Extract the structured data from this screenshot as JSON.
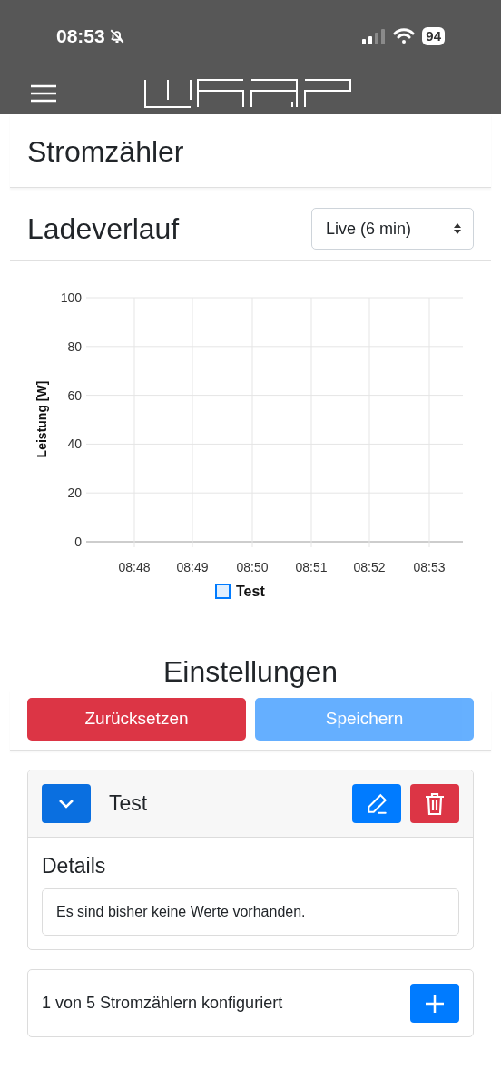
{
  "status_bar": {
    "time": "08:53",
    "battery": "94"
  },
  "sections": [
    {
      "title": "Stromzähler"
    }
  ],
  "history": {
    "title": "Ladeverlauf",
    "range_select": {
      "value": "Live (6 min)"
    },
    "chart_data": {
      "type": "line",
      "ylabel": "Leistung [W]",
      "categories": [
        "08:48",
        "08:49",
        "08:50",
        "08:51",
        "08:52",
        "08:53"
      ],
      "ylim": [
        0,
        100
      ],
      "yticks": [
        0,
        20,
        40,
        60,
        80,
        100
      ],
      "grid": true,
      "series": [
        {
          "name": "Test",
          "color": "#007bff",
          "values": [
            null,
            null,
            null,
            null,
            null,
            null
          ]
        }
      ]
    }
  },
  "settings": {
    "title": "Einstellungen",
    "buttons": [
      {
        "label": "Zurücksetzen",
        "kind": "danger",
        "disabled": false
      },
      {
        "label": "Speichern",
        "kind": "primary",
        "disabled": true
      }
    ]
  },
  "meters": [
    {
      "name": "Test",
      "expanded": true,
      "details_title": "Details",
      "details_text": "Es sind bisher keine Werte vorhanden."
    }
  ],
  "footer": {
    "text": "1 von 5 Stromzählern konfiguriert"
  }
}
